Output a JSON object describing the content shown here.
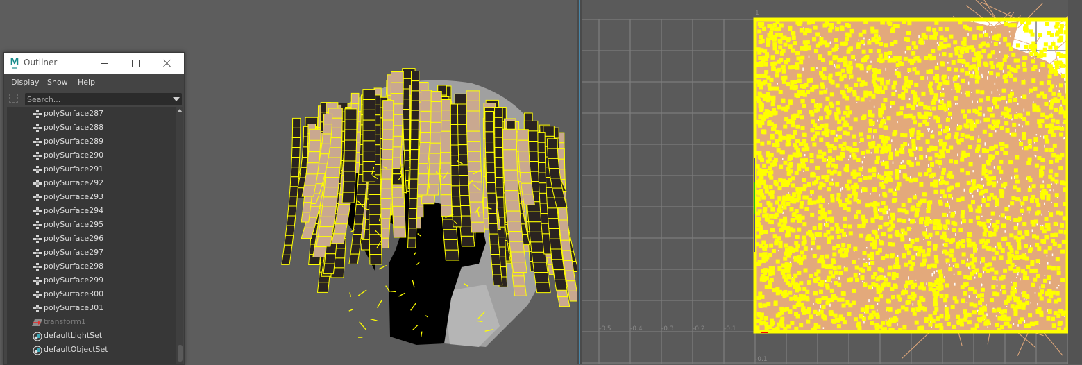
{
  "outliner": {
    "window_title": "Outliner",
    "logo_letter": "M",
    "window_controls": {
      "minimize": "minimize",
      "maximize": "maximize",
      "close": "close"
    },
    "menu": [
      "Display",
      "Show",
      "Help"
    ],
    "search": {
      "placeholder": "Search...",
      "value": ""
    },
    "items": [
      {
        "label": "polySurface287",
        "icon": "mesh-icon",
        "dim": false
      },
      {
        "label": "polySurface288",
        "icon": "mesh-icon",
        "dim": false
      },
      {
        "label": "polySurface289",
        "icon": "mesh-icon",
        "dim": false
      },
      {
        "label": "polySurface290",
        "icon": "mesh-icon",
        "dim": false
      },
      {
        "label": "polySurface291",
        "icon": "mesh-icon",
        "dim": false
      },
      {
        "label": "polySurface292",
        "icon": "mesh-icon",
        "dim": false
      },
      {
        "label": "polySurface293",
        "icon": "mesh-icon",
        "dim": false
      },
      {
        "label": "polySurface294",
        "icon": "mesh-icon",
        "dim": false
      },
      {
        "label": "polySurface295",
        "icon": "mesh-icon",
        "dim": false
      },
      {
        "label": "polySurface296",
        "icon": "mesh-icon",
        "dim": false
      },
      {
        "label": "polySurface297",
        "icon": "mesh-icon",
        "dim": false
      },
      {
        "label": "polySurface298",
        "icon": "mesh-icon",
        "dim": false
      },
      {
        "label": "polySurface299",
        "icon": "mesh-icon",
        "dim": false
      },
      {
        "label": "polySurface300",
        "icon": "mesh-icon",
        "dim": false
      },
      {
        "label": "polySurface301",
        "icon": "mesh-icon",
        "dim": false
      },
      {
        "label": "transform1",
        "icon": "transform-icon",
        "dim": true
      },
      {
        "label": "defaultLightSet",
        "icon": "set-icon",
        "dim": false
      },
      {
        "label": "defaultObjectSet",
        "icon": "set-icon",
        "dim": false
      }
    ]
  },
  "viewport": {
    "scene": "hair mesh with wireframe on shaded",
    "colors": {
      "background": "#5d5d5d",
      "wireframe": "#ffff00",
      "head_shade": "#a0a0a0",
      "inner_dark": "#000000",
      "strand_light": "#c9a890",
      "strand_dark": "#2a2320"
    }
  },
  "uv_editor": {
    "u_tick_labels": [
      "-0.5",
      "-0.4",
      "-0.3",
      "-0.2",
      "-0.1"
    ],
    "v_tick_labels": [
      "-0.1"
    ],
    "tile_corner_labels": [
      "1",
      "1"
    ],
    "uv_range": {
      "u": [
        0,
        1
      ],
      "v": [
        0,
        1
      ]
    },
    "colors": {
      "background": "#5a5a5a",
      "tile": "#ffffff",
      "uv_fill": "#e3a97b",
      "selected_uvs": "#ffff00",
      "grid": "#7c7c7c",
      "u_axis": "#ff0000",
      "v_axis": "#00d000",
      "border_blue": "#1010c0"
    }
  }
}
